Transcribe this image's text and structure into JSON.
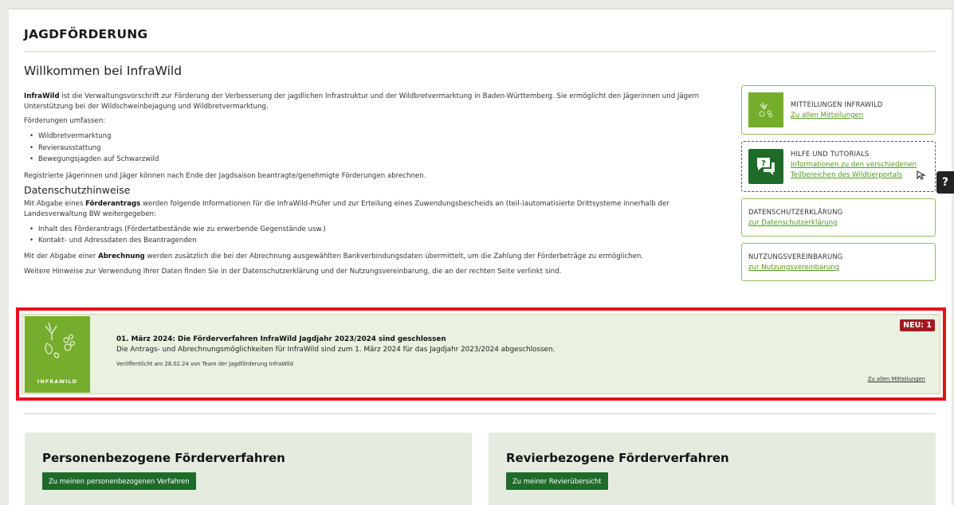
{
  "header": {
    "title": "JAGDFÖRDERUNG"
  },
  "intro": {
    "heading": "Willkommen bei InfraWild",
    "p1_bold": "InfraWild",
    "p1_rest": " ist die Verwaltungsvorschrift zur Förderung der Verbesserung der jagdlichen Infrastruktur und der Wildbretvermarktung in Baden-Württemberg. Sie ermöglicht den Jägerinnen und Jägern Unterstützung bei der Wildschweinbejagung und Wildbretvermarktung.",
    "p2": "Förderungen umfassen:",
    "list": [
      "Wildbretvermarktung",
      "Revierausstattung",
      "Bewegungsjagden auf Schwarzwild"
    ],
    "p3": "Registrierte Jägerinnen und Jäger können nach Ende der Jagdsaison beantragte/genehmigte Förderungen abrechnen."
  },
  "privacy": {
    "heading": "Datenschutzhinweise",
    "p1_a": "Mit Abgabe eines ",
    "p1_bold": "Förderantrags",
    "p1_b": " werden folgende Informationen für die InfraWild-Prüfer und zur Erteilung eines Zuwendungsbescheids an (teil-)automatisierte Drittsysteme innerhalb der Landesverwaltung BW weitergegeben:",
    "list": [
      "Inhalt des Förderantrags (Fördertatbestände wie zu erwerbende Gegenstände usw.)",
      "Kontakt- und Adressdaten des Beantragenden"
    ],
    "p2_a": "Mit der Abgabe einer ",
    "p2_bold": "Abrechnung",
    "p2_b": " werden zusätzlich die bei der Abrechnung ausgewählten Bankverbindungsdaten übermittelt, um die Zahlung der Förderbeträge zu ermöglichen.",
    "p3": "Weitere Hinweise zur Verwendung Ihrer Daten finden Sie in der Datenschutzerklärung und der Nutzungsvereinbarung, die an der rechten Seite verlinkt sind."
  },
  "sidebar": {
    "news": {
      "title": "MITTEILUNGEN INFRAWILD",
      "link": "Zu allen Mitteilungen"
    },
    "help": {
      "title": "HILFE UND TUTORIALS",
      "link1": "Informationen zu den verschiedenen",
      "link2": "Teilbereichen des Wildtierportals"
    },
    "privacy": {
      "title": "DATENSCHUTZERKLÄRUNG",
      "link": "zur Datenschutzerklärung"
    },
    "terms": {
      "title": "NUTZUNGSVEREINBARUNG",
      "link": "zur Nutzungsvereinbarung"
    }
  },
  "help_tab": {
    "label": "?"
  },
  "news_item": {
    "logo_label": "INFRAWILD",
    "title": "01. März 2024: Die Förderverfahren InfraWild Jagdjahr 2023/2024 sind geschlossen",
    "text": "Die Antrags- und Abrechnungsmöglichkeiten für InfraWild sind zum 1. März 2024 für das Jagdjahr 2023/2024 abgeschlossen.",
    "meta": "Veröffentlicht am 28.02.24 von Team der Jagdförderung InfraWild",
    "badge": "NEU: 1",
    "link": "Zu allen Mitteilungen"
  },
  "panels": {
    "personal": {
      "title": "Personenbezogene Förderverfahren",
      "button": "Zu meinen personenbezogenen Verfahren"
    },
    "district": {
      "title": "Revierbezogene Förderverfahren",
      "button": "Zu meiner Revierübersicht"
    }
  },
  "colors": {
    "accent_green": "#76ad2c",
    "dark_green": "#1e6b2a",
    "badge_red": "#a11a22",
    "highlight_red": "#e8101a"
  }
}
